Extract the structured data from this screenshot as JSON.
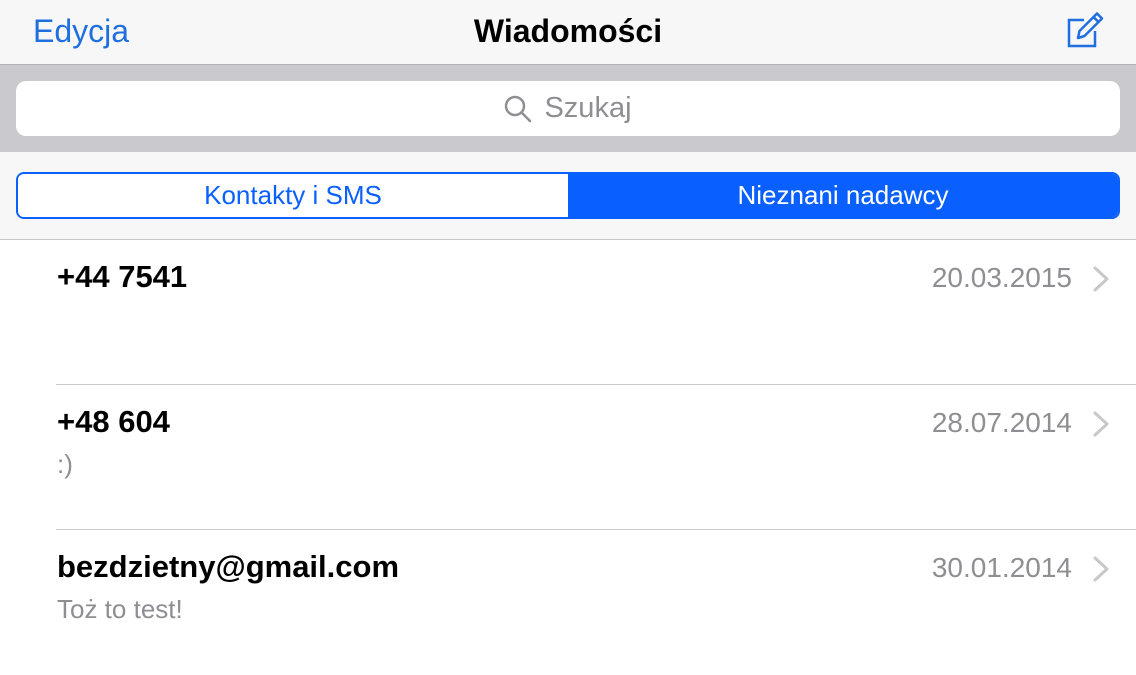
{
  "nav": {
    "left_button": "Edycja",
    "title": "Wiadomości",
    "compose_icon": "compose-icon"
  },
  "search": {
    "placeholder": "Szukaj",
    "icon": "search-icon"
  },
  "segments": {
    "items": [
      "Kontakty i SMS",
      "Nieznani nadawcy"
    ],
    "selected": "Nieznani nadawcy"
  },
  "colors": {
    "accent": "#0a60ff",
    "link": "#1f6fe0",
    "secondary_text": "#8e8e93"
  },
  "messages": [
    {
      "sender": "+44 7541",
      "date": "20.03.2015",
      "preview": ""
    },
    {
      "sender": "+48 604",
      "date": "28.07.2014",
      "preview": ":)"
    },
    {
      "sender": "bezdzietny@gmail.com",
      "date": "30.01.2014",
      "preview": "Toż to test!"
    }
  ]
}
